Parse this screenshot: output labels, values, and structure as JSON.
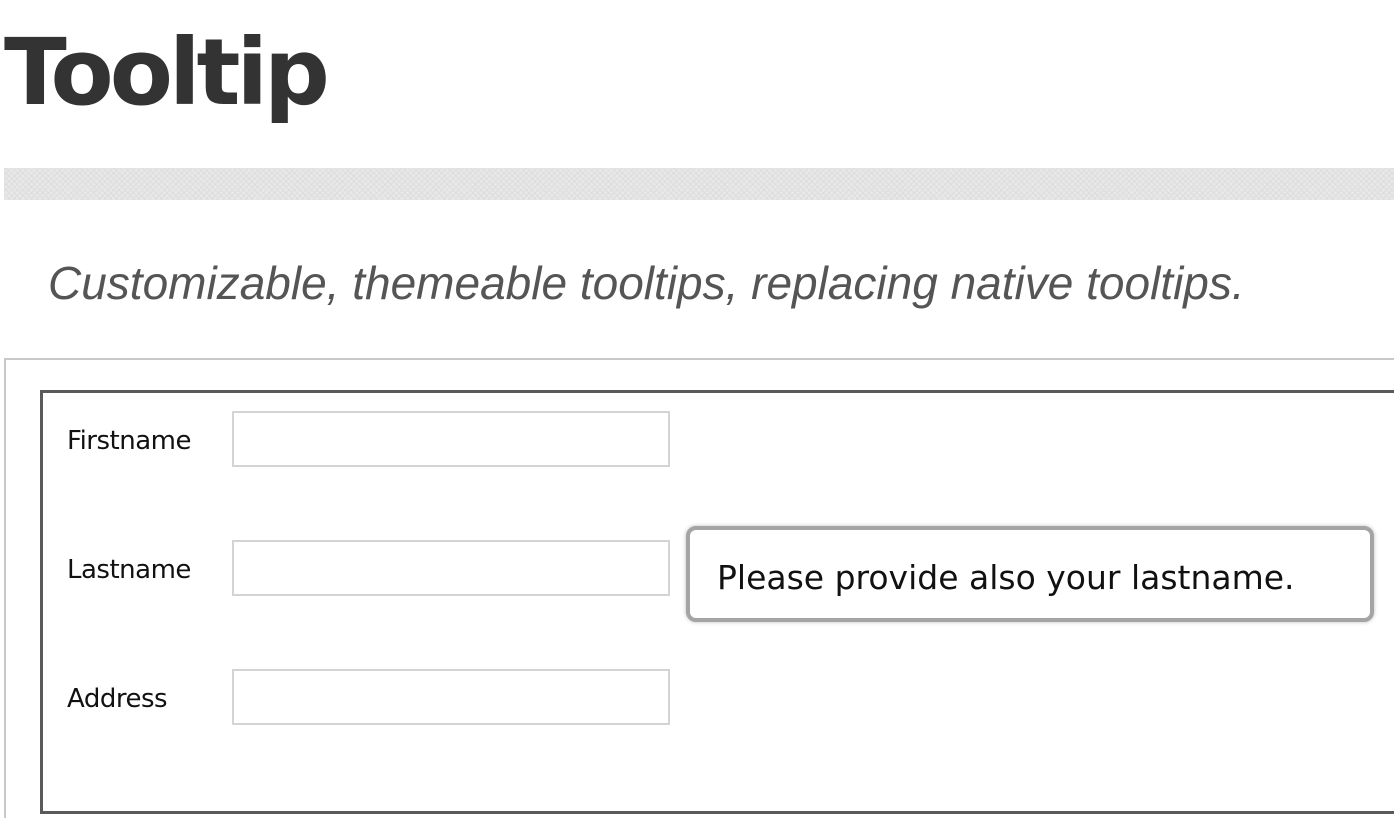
{
  "header": {
    "title": "Tooltip",
    "subtitle": "Customizable, themeable tooltips, replacing native tooltips."
  },
  "form": {
    "fields": [
      {
        "label": "Firstname",
        "value": "",
        "placeholder": ""
      },
      {
        "label": "Lastname",
        "value": "",
        "placeholder": ""
      },
      {
        "label": "Address",
        "value": "",
        "placeholder": ""
      }
    ]
  },
  "tooltip": {
    "text": "Please provide also your lastname."
  }
}
